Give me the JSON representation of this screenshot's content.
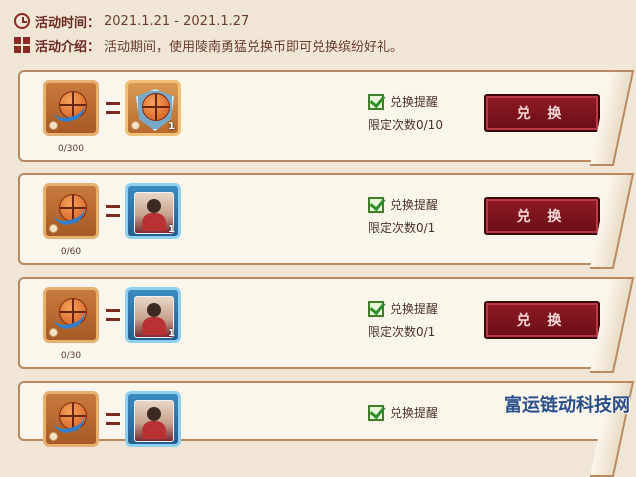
{
  "header": {
    "time_label": "活动时间：",
    "time_value": "2021.1.21 - 2021.1.27",
    "intro_label": "活动介绍：",
    "intro_value": "活动期间，使用陵南勇猛兑换币即可兑换缤纷好礼。"
  },
  "cards": [
    {
      "coin_required": "0/300",
      "reward_qty": "1",
      "remind_label": "兑换提醒",
      "limit_text": "限定次数0/10",
      "button_label": "兑 换",
      "reward_icon": "basketball-badge-icon"
    },
    {
      "coin_required": "0/60",
      "reward_qty": "1",
      "remind_label": "兑换提醒",
      "limit_text": "限定次数0/1",
      "button_label": "兑 换",
      "reward_icon": "player-card-icon"
    },
    {
      "coin_required": "0/30",
      "reward_qty": "1",
      "remind_label": "兑换提醒",
      "limit_text": "限定次数0/1",
      "button_label": "兑 换",
      "reward_icon": "player-card-icon"
    },
    {
      "coin_required": "",
      "reward_qty": "",
      "remind_label": "兑换提醒",
      "limit_text": "",
      "button_label": "",
      "reward_icon": "player-card-icon"
    }
  ],
  "watermark": "富运链动科技网"
}
